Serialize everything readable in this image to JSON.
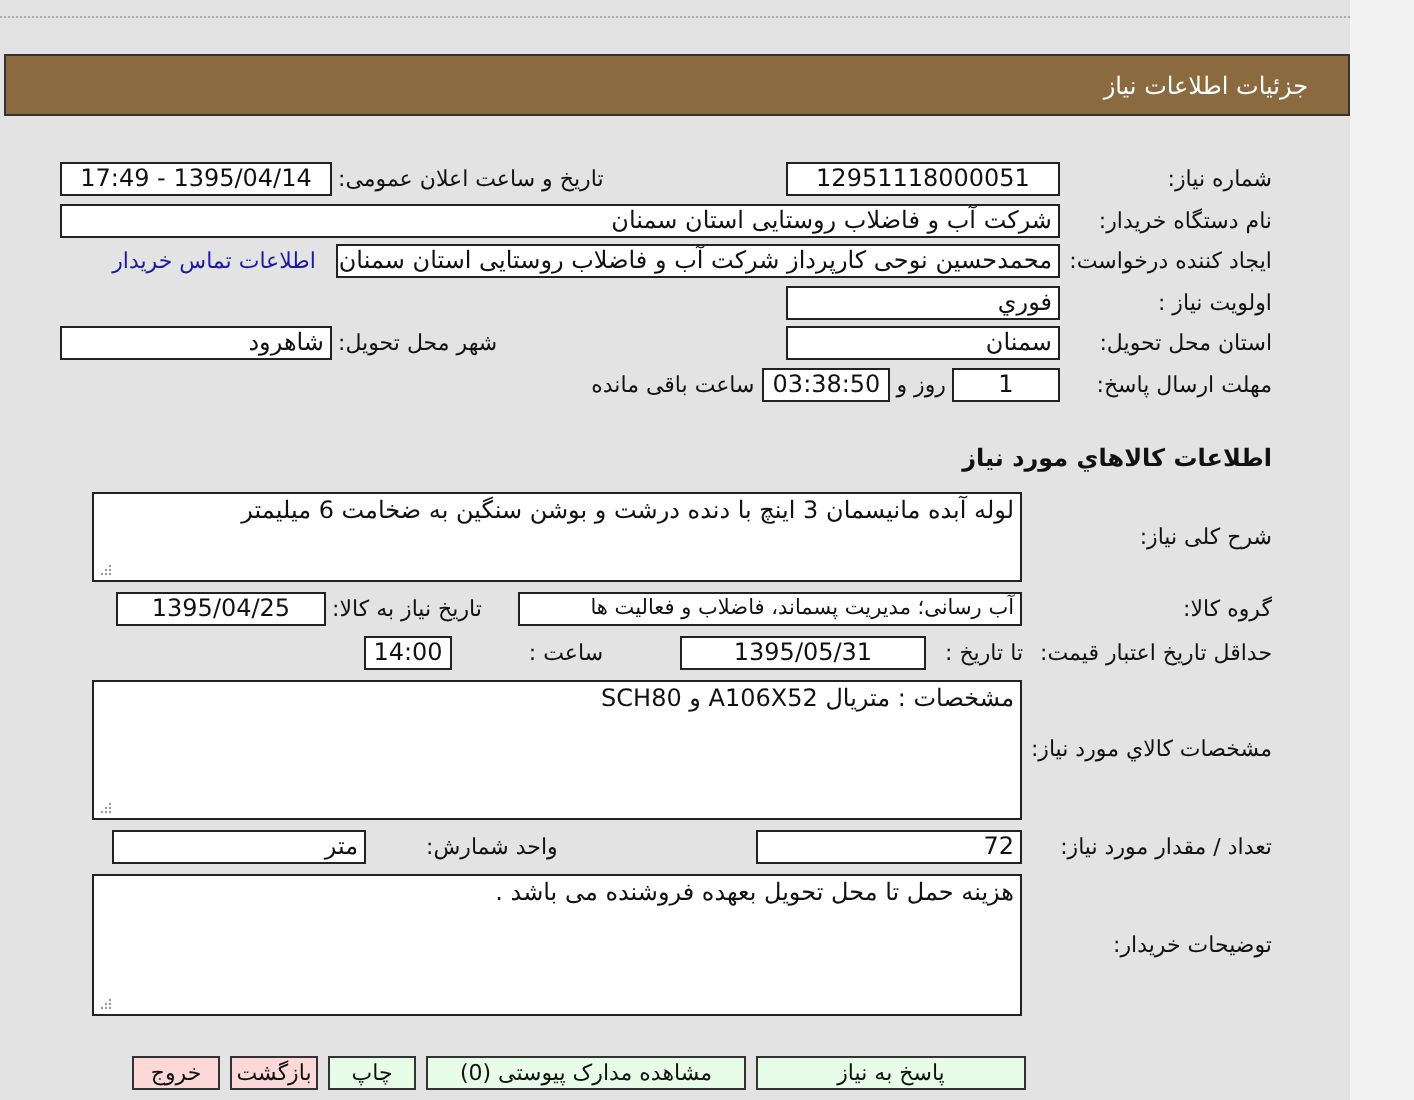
{
  "title": "جزئیات اطلاعات نیاز",
  "need_number": {
    "label": "شماره نیاز:",
    "value": "12951118000051"
  },
  "announce": {
    "label": "تاریخ و ساعت اعلان عمومی:",
    "value": "1395/04/14 - 17:49"
  },
  "buyer": {
    "label": "نام دستگاه خریدار:",
    "value": "شرکت آب و فاضلاب روستایی استان سمنان"
  },
  "requester": {
    "label": "ایجاد کننده درخواست:",
    "value": "محمدحسین نوحی کارپرداز شرکت آب و فاضلاب روستایی استان سمنان"
  },
  "contact_link": "اطلاعات تماس خریدار",
  "priority": {
    "label": "اولویت نیاز :",
    "value": "فوري"
  },
  "province": {
    "label": "استان محل تحویل:",
    "value": "سمنان"
  },
  "city": {
    "label": "شهر محل تحویل:",
    "value": "شاهرود"
  },
  "deadline": {
    "label": "مهلت ارسال پاسخ:",
    "days": "1",
    "days_suffix": "روز و",
    "time": "03:38:50",
    "time_suffix": "ساعت باقی مانده"
  },
  "goods_heading": "اطلاعات کالاهاي مورد نياز",
  "description": {
    "label": "شرح کلی نیاز:",
    "value": "لوله آبده مانیسمان 3 اینچ با دنده درشت و بوشن سنگین به ضخامت 6 میلیمتر"
  },
  "group": {
    "label": "گروه کالا:",
    "value": "آب رسانی؛ مدیریت پسماند، فاضلاب و فعالیت ها"
  },
  "need_date": {
    "label": "تاریخ نیاز به کالا:",
    "value": "1395/04/25"
  },
  "validity": {
    "label": "حداقل تاریخ اعتبار قیمت:",
    "date_label": "تا تاریخ :",
    "date": "1395/05/31",
    "time_label": "ساعت :",
    "time": "14:00"
  },
  "specs": {
    "label": "مشخصات کالاي مورد نياز:",
    "value": "مشخصات : متریال A106X52 و SCH80"
  },
  "quantity": {
    "label": "تعداد / مقدار مورد نیاز:",
    "value": "72"
  },
  "unit": {
    "label": "واحد شمارش:",
    "value": "متر"
  },
  "notes": {
    "label": "توضیحات خریدار:",
    "value": "هزینه حمل تا محل تحویل بعهده فروشنده می باشد ."
  },
  "buttons": [
    {
      "label": "پاسخ به نیاز",
      "kind": "primary"
    },
    {
      "label": "مشاهده مدارک پیوستی (0)",
      "kind": "primary"
    },
    {
      "label": "چاپ",
      "kind": "primary"
    },
    {
      "label": "بازگشت",
      "kind": "danger"
    },
    {
      "label": "خروج",
      "kind": "danger"
    }
  ]
}
